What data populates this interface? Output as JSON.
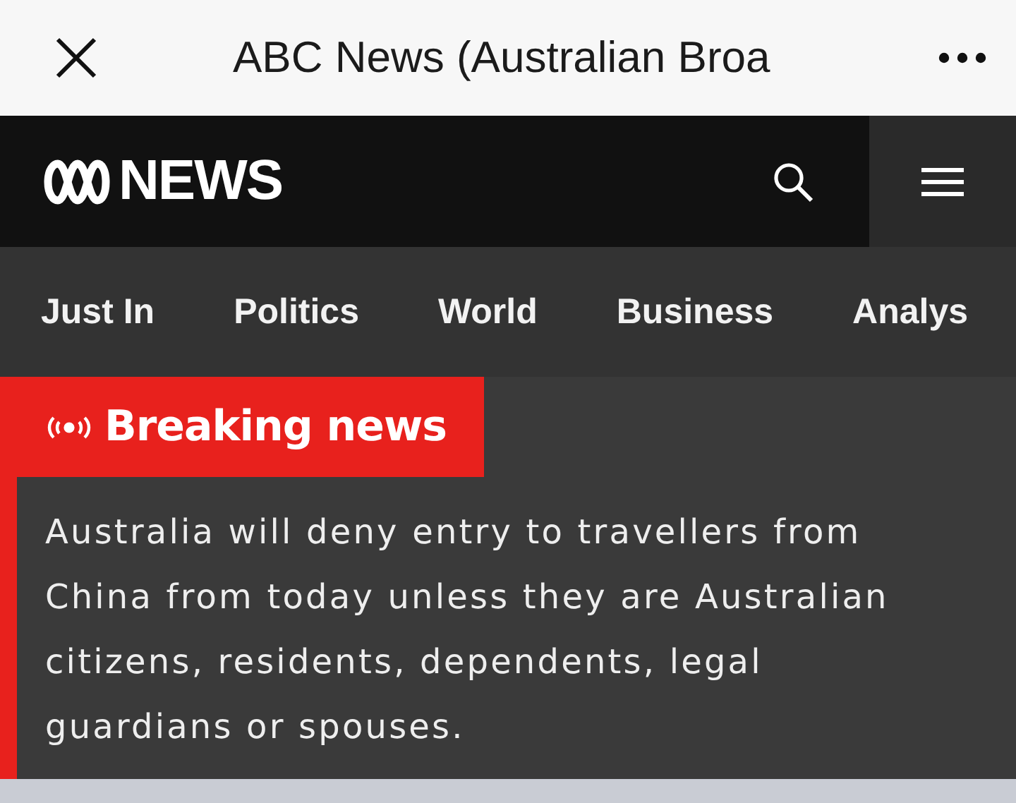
{
  "top_bar": {
    "title": "ABC News (Australian Broa"
  },
  "header": {
    "brand": "NEWS"
  },
  "nav": [
    {
      "label": "Just In"
    },
    {
      "label": "Politics"
    },
    {
      "label": "World"
    },
    {
      "label": "Business"
    },
    {
      "label": "Analys"
    }
  ],
  "breaking": {
    "label": "Breaking news",
    "text": "Australia will deny entry to travellers from China from today unless they are Australian citizens, residents, dependents, legal guardians or spouses."
  }
}
